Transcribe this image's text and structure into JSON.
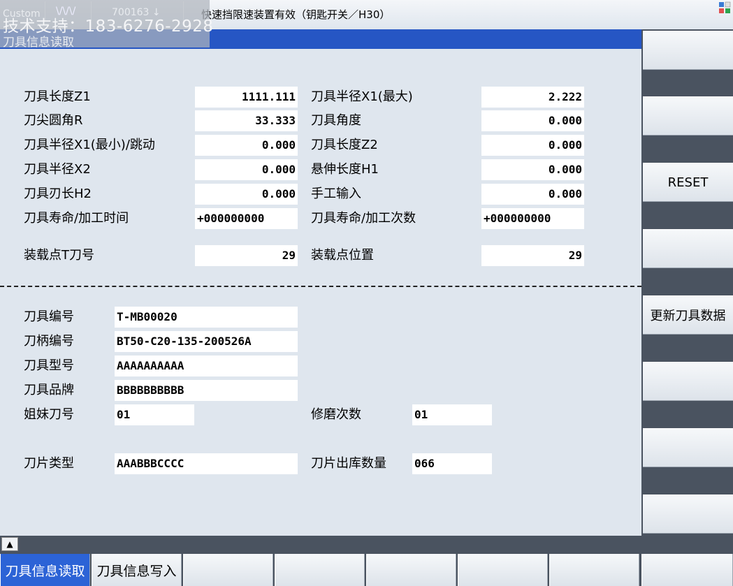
{
  "header": {
    "alarm_text": "快速挡限速装置有效（钥匙开关／H30）",
    "overlay_custom": "Custom",
    "overlay_wave": "\\/\\/\\/",
    "overlay_num": "700163 ↓",
    "overlay_support": "技术支持：183-6276-2928",
    "overlay_title": "刀具信息读取"
  },
  "upper_fields": {
    "tool_length_z1": {
      "label": "刀具长度Z1",
      "value": "1111.111"
    },
    "tool_radius_x1_max": {
      "label": "刀具半径X1(最大)",
      "value": "2.222"
    },
    "nose_radius_r": {
      "label": "刀尖圆角R",
      "value": "33.333"
    },
    "tool_angle": {
      "label": "刀具角度",
      "value": "0.000"
    },
    "tool_radius_x1_min": {
      "label": "刀具半径X1(最小)/跳动",
      "value": "0.000"
    },
    "tool_length_z2": {
      "label": "刀具长度Z2",
      "value": "0.000"
    },
    "tool_radius_x2": {
      "label": "刀具半径X2",
      "value": "0.000"
    },
    "overhang_h1": {
      "label": "悬伸长度H1",
      "value": "0.000"
    },
    "edge_length_h2": {
      "label": "刀具刃长H2",
      "value": "0.000"
    },
    "manual_input": {
      "label": "手工输入",
      "value": "0.000"
    },
    "life_time": {
      "label": "刀具寿命/加工时间",
      "value": "+000000000"
    },
    "life_count": {
      "label": "刀具寿命/加工次数",
      "value": "+000000000"
    },
    "load_point_t": {
      "label": "装载点T刀号",
      "value": "29"
    },
    "load_point_pos": {
      "label": "装载点位置",
      "value": "29"
    }
  },
  "lower_fields": {
    "tool_id": {
      "label": "刀具编号",
      "value": "T-MB00020"
    },
    "holder_id": {
      "label": "刀柄编号",
      "value": "BT50-C20-135-200526A"
    },
    "tool_model": {
      "label": "刀具型号",
      "value": "AAAAAAAAAA"
    },
    "tool_brand": {
      "label": "刀具品牌",
      "value": "BBBBBBBBBB"
    },
    "sister_tool": {
      "label": "姐妹刀号",
      "value": "01"
    },
    "regrind_count": {
      "label": "修磨次数",
      "value": "01"
    },
    "insert_type": {
      "label": "刀片类型",
      "value": "AAABBBCCCC"
    },
    "insert_stock_qty": {
      "label": "刀片出库数量",
      "value": "066"
    }
  },
  "right_softkeys": [
    "",
    "",
    "RESET",
    "",
    "更新刀具数据",
    "",
    "",
    ""
  ],
  "bottom_softkeys": [
    "刀具信息读取",
    "刀具信息写入",
    "",
    "",
    "",
    "",
    "",
    ""
  ],
  "colors": {
    "title_strip": "#2656c4",
    "active_softkey": "#2c63d6",
    "panel_bg": "#dfe6ee",
    "softkey_frame": "#4a5360"
  }
}
